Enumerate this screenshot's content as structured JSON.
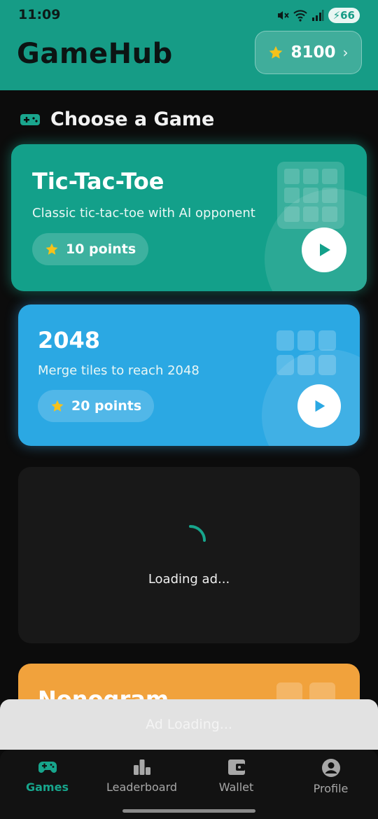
{
  "status_bar": {
    "time": "11:09",
    "battery": "66",
    "icons": [
      "mute-icon",
      "wifi-icon",
      "signal-icon",
      "battery-icon"
    ]
  },
  "header": {
    "title": "GameHub",
    "points": "8100",
    "accent_color": "#169c86"
  },
  "section": {
    "title": "Choose a Game",
    "icon": "gamepad-icon"
  },
  "games": [
    {
      "title": "Tic-Tac-Toe",
      "description": "Classic tic-tac-toe with AI opponent",
      "points": "10 points",
      "color": "#13a08a",
      "play_icon_color": "#13a08a"
    },
    {
      "title": "2048",
      "description": "Merge tiles to reach 2048",
      "points": "20 points",
      "color": "#2ba8e3",
      "play_icon_color": "#2ba8e3"
    },
    {
      "title": "Nonogram",
      "color": "#f1a23c"
    }
  ],
  "ad": {
    "loading_text": "Loading ad...",
    "banner_text": "Ad Loading..."
  },
  "nav": {
    "items": [
      {
        "label": "Games",
        "icon": "gamepad-icon",
        "active": true
      },
      {
        "label": "Leaderboard",
        "icon": "bar-chart-icon",
        "active": false
      },
      {
        "label": "Wallet",
        "icon": "wallet-icon",
        "active": false
      },
      {
        "label": "Profile",
        "icon": "profile-icon",
        "active": false
      }
    ]
  }
}
